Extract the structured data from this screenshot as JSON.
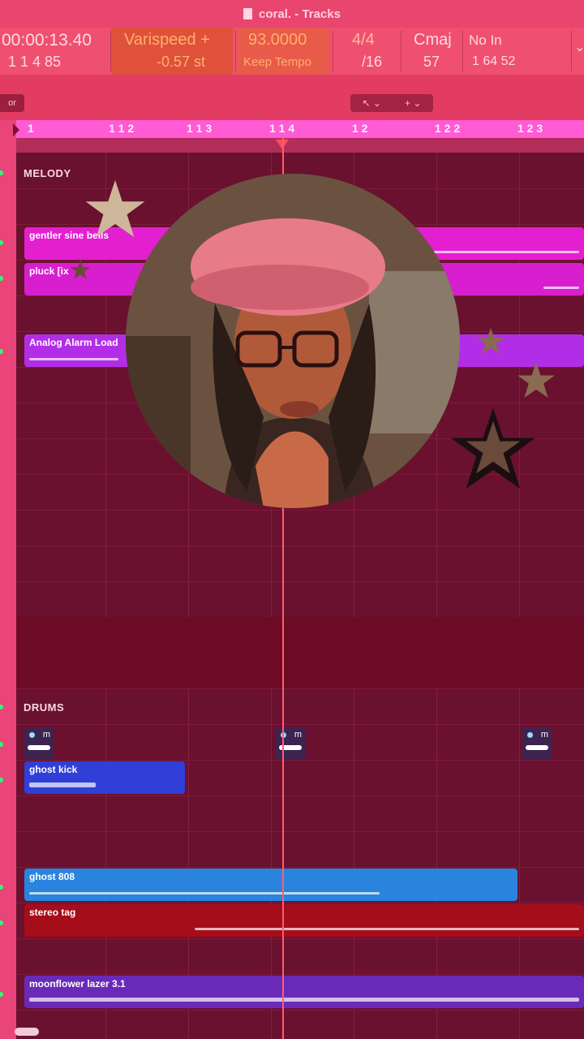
{
  "window": {
    "title": "coral. - Tracks",
    "doc_icon": "document-icon"
  },
  "lcd": {
    "time": "00:00:13.40",
    "bars": "1  1  4    85",
    "varispeed_label": "Varispeed +",
    "varispeed_value": "-0.57 st",
    "tempo": "93.0000",
    "tempo_mode": "Keep Tempo",
    "signature_top": "4/4",
    "signature_bottom": "/16",
    "key": "Cmaj",
    "key_sub": "57",
    "midi_in": "No In",
    "midi_sub": "1  64  52",
    "chevron": "⌄"
  },
  "toolbar": {
    "left_btn": "or",
    "pointer_tool": "↖ ⌄",
    "plus_tool": "+ ⌄"
  },
  "ruler": {
    "labels": [
      {
        "text": "1"
      },
      {
        "text": "1 1 2"
      },
      {
        "text": "1 1 3"
      },
      {
        "text": "1 1 4"
      },
      {
        "text": "1 2"
      },
      {
        "text": "1 2 2"
      },
      {
        "text": "1 2 3"
      }
    ]
  },
  "folders": {
    "melody": "MELODY",
    "drums": "DRUMS"
  },
  "regions": {
    "gentler_sine": "gentler sine bells",
    "pluck": "pluck [ix",
    "analog_alarm": "Analog Alarm Load",
    "ghost_kick": "ghost kick",
    "ghost_808": "ghost 808",
    "stereo_tag": "stereo tag",
    "moonflower": "moonflower lazer 3.1"
  },
  "mini_label": "m",
  "colors": {
    "accent_pink": "#ff5bd5",
    "region_magenta": "#e31fd0",
    "region_purple": "#b22ee6",
    "region_blue": "#2f3fd8",
    "region_sky": "#2a84dd",
    "region_red": "#a60d1a",
    "region_violet": "#6a2ab8"
  }
}
